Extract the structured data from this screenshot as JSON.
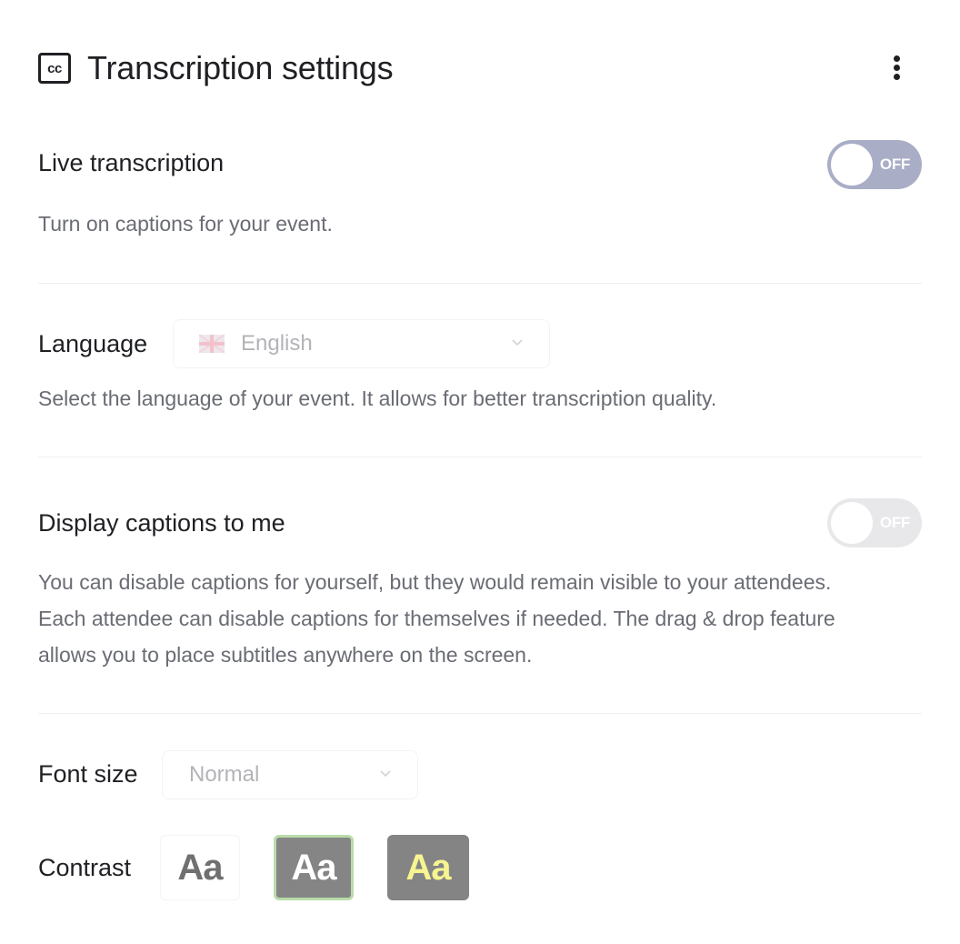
{
  "header": {
    "icon": "closed-captions-icon",
    "title": "Transcription settings",
    "more_icon": "more-vertical-icon"
  },
  "live_transcription": {
    "label": "Live transcription",
    "toggle_state": "OFF",
    "description": "Turn on captions for your event."
  },
  "language": {
    "label": "Language",
    "selected_value": "English",
    "flag_icon": "uk-flag-icon",
    "description": "Select the language of your event. It allows for better transcription quality."
  },
  "display_captions": {
    "label": "Display captions to me",
    "toggle_state": "OFF",
    "description_lines": [
      "You can disable captions for yourself, but they would remain visible to your attendees.",
      "Each attendee can disable captions for themselves if needed. The drag & drop feature",
      "allows you to place subtitles anywhere on the screen."
    ]
  },
  "font_size": {
    "label": "Font size",
    "selected_value": "Normal"
  },
  "contrast": {
    "label": "Contrast",
    "options": [
      {
        "sample": "Aa",
        "style": "light",
        "background": "#ffffff",
        "text_color": "#707070",
        "selected": false
      },
      {
        "sample": "Aa",
        "style": "dark",
        "background": "#858585",
        "text_color": "#ffffff",
        "selected": true
      },
      {
        "sample": "Aa",
        "style": "yellow-on-dark",
        "background": "#848484",
        "text_color": "#f6f591",
        "selected": false
      }
    ],
    "selected_border_color": "#b9dcaa"
  },
  "colors": {
    "toggle_off": "#a9adc6",
    "toggle_disabled": "#e8e8eb",
    "text_primary": "#1f2024",
    "text_secondary": "#6a6c74"
  }
}
